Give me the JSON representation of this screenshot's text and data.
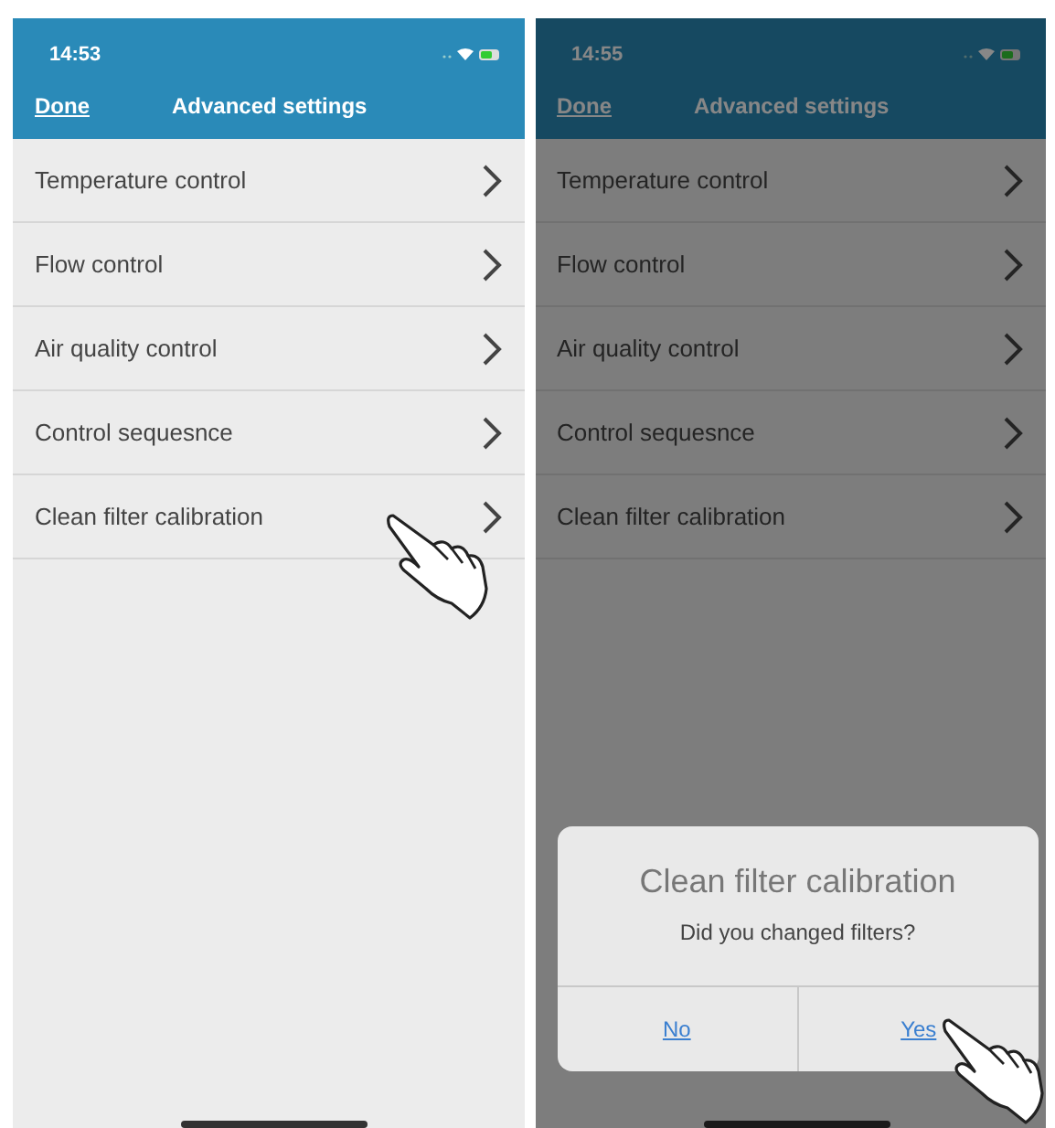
{
  "screens": [
    {
      "time": "14:53",
      "done": "Done",
      "title": "Advanced settings",
      "dimmed": false,
      "items": [
        "Temperature control",
        "Flow control",
        "Air quality control",
        "Control sequesnce",
        "Clean filter calibration"
      ]
    },
    {
      "time": "14:55",
      "done": "Done",
      "title": "Advanced settings",
      "dimmed": true,
      "items": [
        "Temperature control",
        "Flow control",
        "Air quality control",
        "Control sequesnce",
        "Clean filter calibration"
      ],
      "dialog": {
        "title": "Clean filter calibration",
        "message": "Did you changed filters?",
        "buttons": [
          "No",
          "Yes"
        ]
      }
    }
  ]
}
